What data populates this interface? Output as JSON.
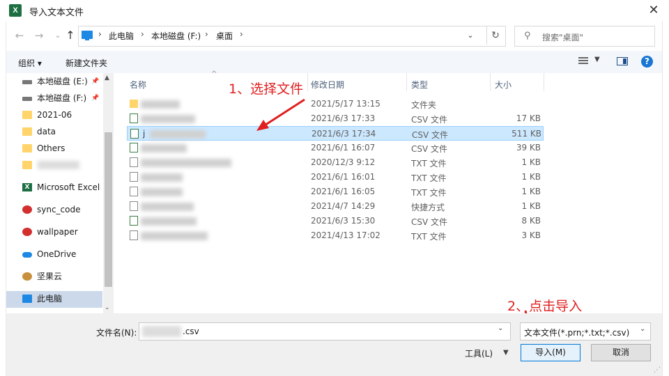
{
  "window": {
    "title": "导入文本文件",
    "app_icon": "excel-icon",
    "close_glyph": "✕"
  },
  "nav": {
    "back": "←",
    "forward": "→",
    "dropdown": "⌄",
    "up": "↑",
    "breadcrumb": [
      "此电脑",
      "本地磁盘 (F:)",
      "桌面"
    ],
    "sep": "›",
    "refresh": "↻",
    "search_placeholder": "搜索\"桌面\""
  },
  "toolbar": {
    "organize": "组织 ▾",
    "new_folder": "新建文件夹"
  },
  "tree": [
    {
      "label": "本地磁盘 (E:)",
      "icon": "drive-icon",
      "pinned": true
    },
    {
      "label": "本地磁盘 (F:)",
      "icon": "drive-icon",
      "pinned": true
    },
    {
      "label": "2021-06",
      "icon": "folder-icon"
    },
    {
      "label": "data",
      "icon": "folder-icon"
    },
    {
      "label": "Others",
      "icon": "folder-icon"
    },
    {
      "label": "",
      "icon": "folder-icon"
    },
    {
      "label": "Microsoft Excel",
      "icon": "excel-icon"
    },
    {
      "label": "sync_code",
      "icon": "app-icon"
    },
    {
      "label": "wallpaper",
      "icon": "app-icon"
    },
    {
      "label": "OneDrive",
      "icon": "onedrive-icon"
    },
    {
      "label": "坚果云",
      "icon": "nutstore-icon"
    },
    {
      "label": "此电脑",
      "icon": "this-pc-icon",
      "selected": true
    }
  ],
  "columns": {
    "name": "名称",
    "modified": "修改日期",
    "type": "类型",
    "size": "大小"
  },
  "files": [
    {
      "date": "2021/5/17 13:15",
      "type": "文件夹",
      "size": "",
      "kind": "folder"
    },
    {
      "date": "2021/6/3 17:33",
      "type": "CSV 文件",
      "size": "17 KB",
      "kind": "csv"
    },
    {
      "date": "2021/6/3 17:34",
      "type": "CSV 文件",
      "size": "511 KB",
      "kind": "csv",
      "selected": true,
      "initial": "j"
    },
    {
      "date": "2021/6/1 16:07",
      "type": "CSV 文件",
      "size": "39 KB",
      "kind": "csv"
    },
    {
      "date": "2020/12/3 9:12",
      "type": "TXT 文件",
      "size": "1 KB",
      "kind": "txt"
    },
    {
      "date": "2021/6/1 16:01",
      "type": "TXT 文件",
      "size": "1 KB",
      "kind": "txt"
    },
    {
      "date": "2021/6/1 16:05",
      "type": "TXT 文件",
      "size": "1 KB",
      "kind": "txt"
    },
    {
      "date": "2021/4/7 14:29",
      "type": "快捷方式",
      "size": "1 KB",
      "kind": "link"
    },
    {
      "date": "2021/6/3 15:30",
      "type": "CSV 文件",
      "size": "8 KB",
      "kind": "csv"
    },
    {
      "date": "2021/4/13 17:02",
      "type": "TXT 文件",
      "size": "3 KB",
      "kind": "txt"
    }
  ],
  "annotations": {
    "step1": "1、选择文件",
    "step2": "2、点击导入",
    "color": "#e02020"
  },
  "bottom": {
    "filename_label": "文件名(N):",
    "filename_value": ".csv",
    "filter_value": "文本文件(*.prn;*.txt;*.csv)",
    "tools": "工具(L)",
    "import": "导入(M)",
    "cancel": "取消"
  },
  "colors": {
    "selection": "#cce8ff",
    "tree_selection": "#ccd9ea",
    "toolbar_bg": "#f3f6fb",
    "accent": "#0078d7"
  }
}
